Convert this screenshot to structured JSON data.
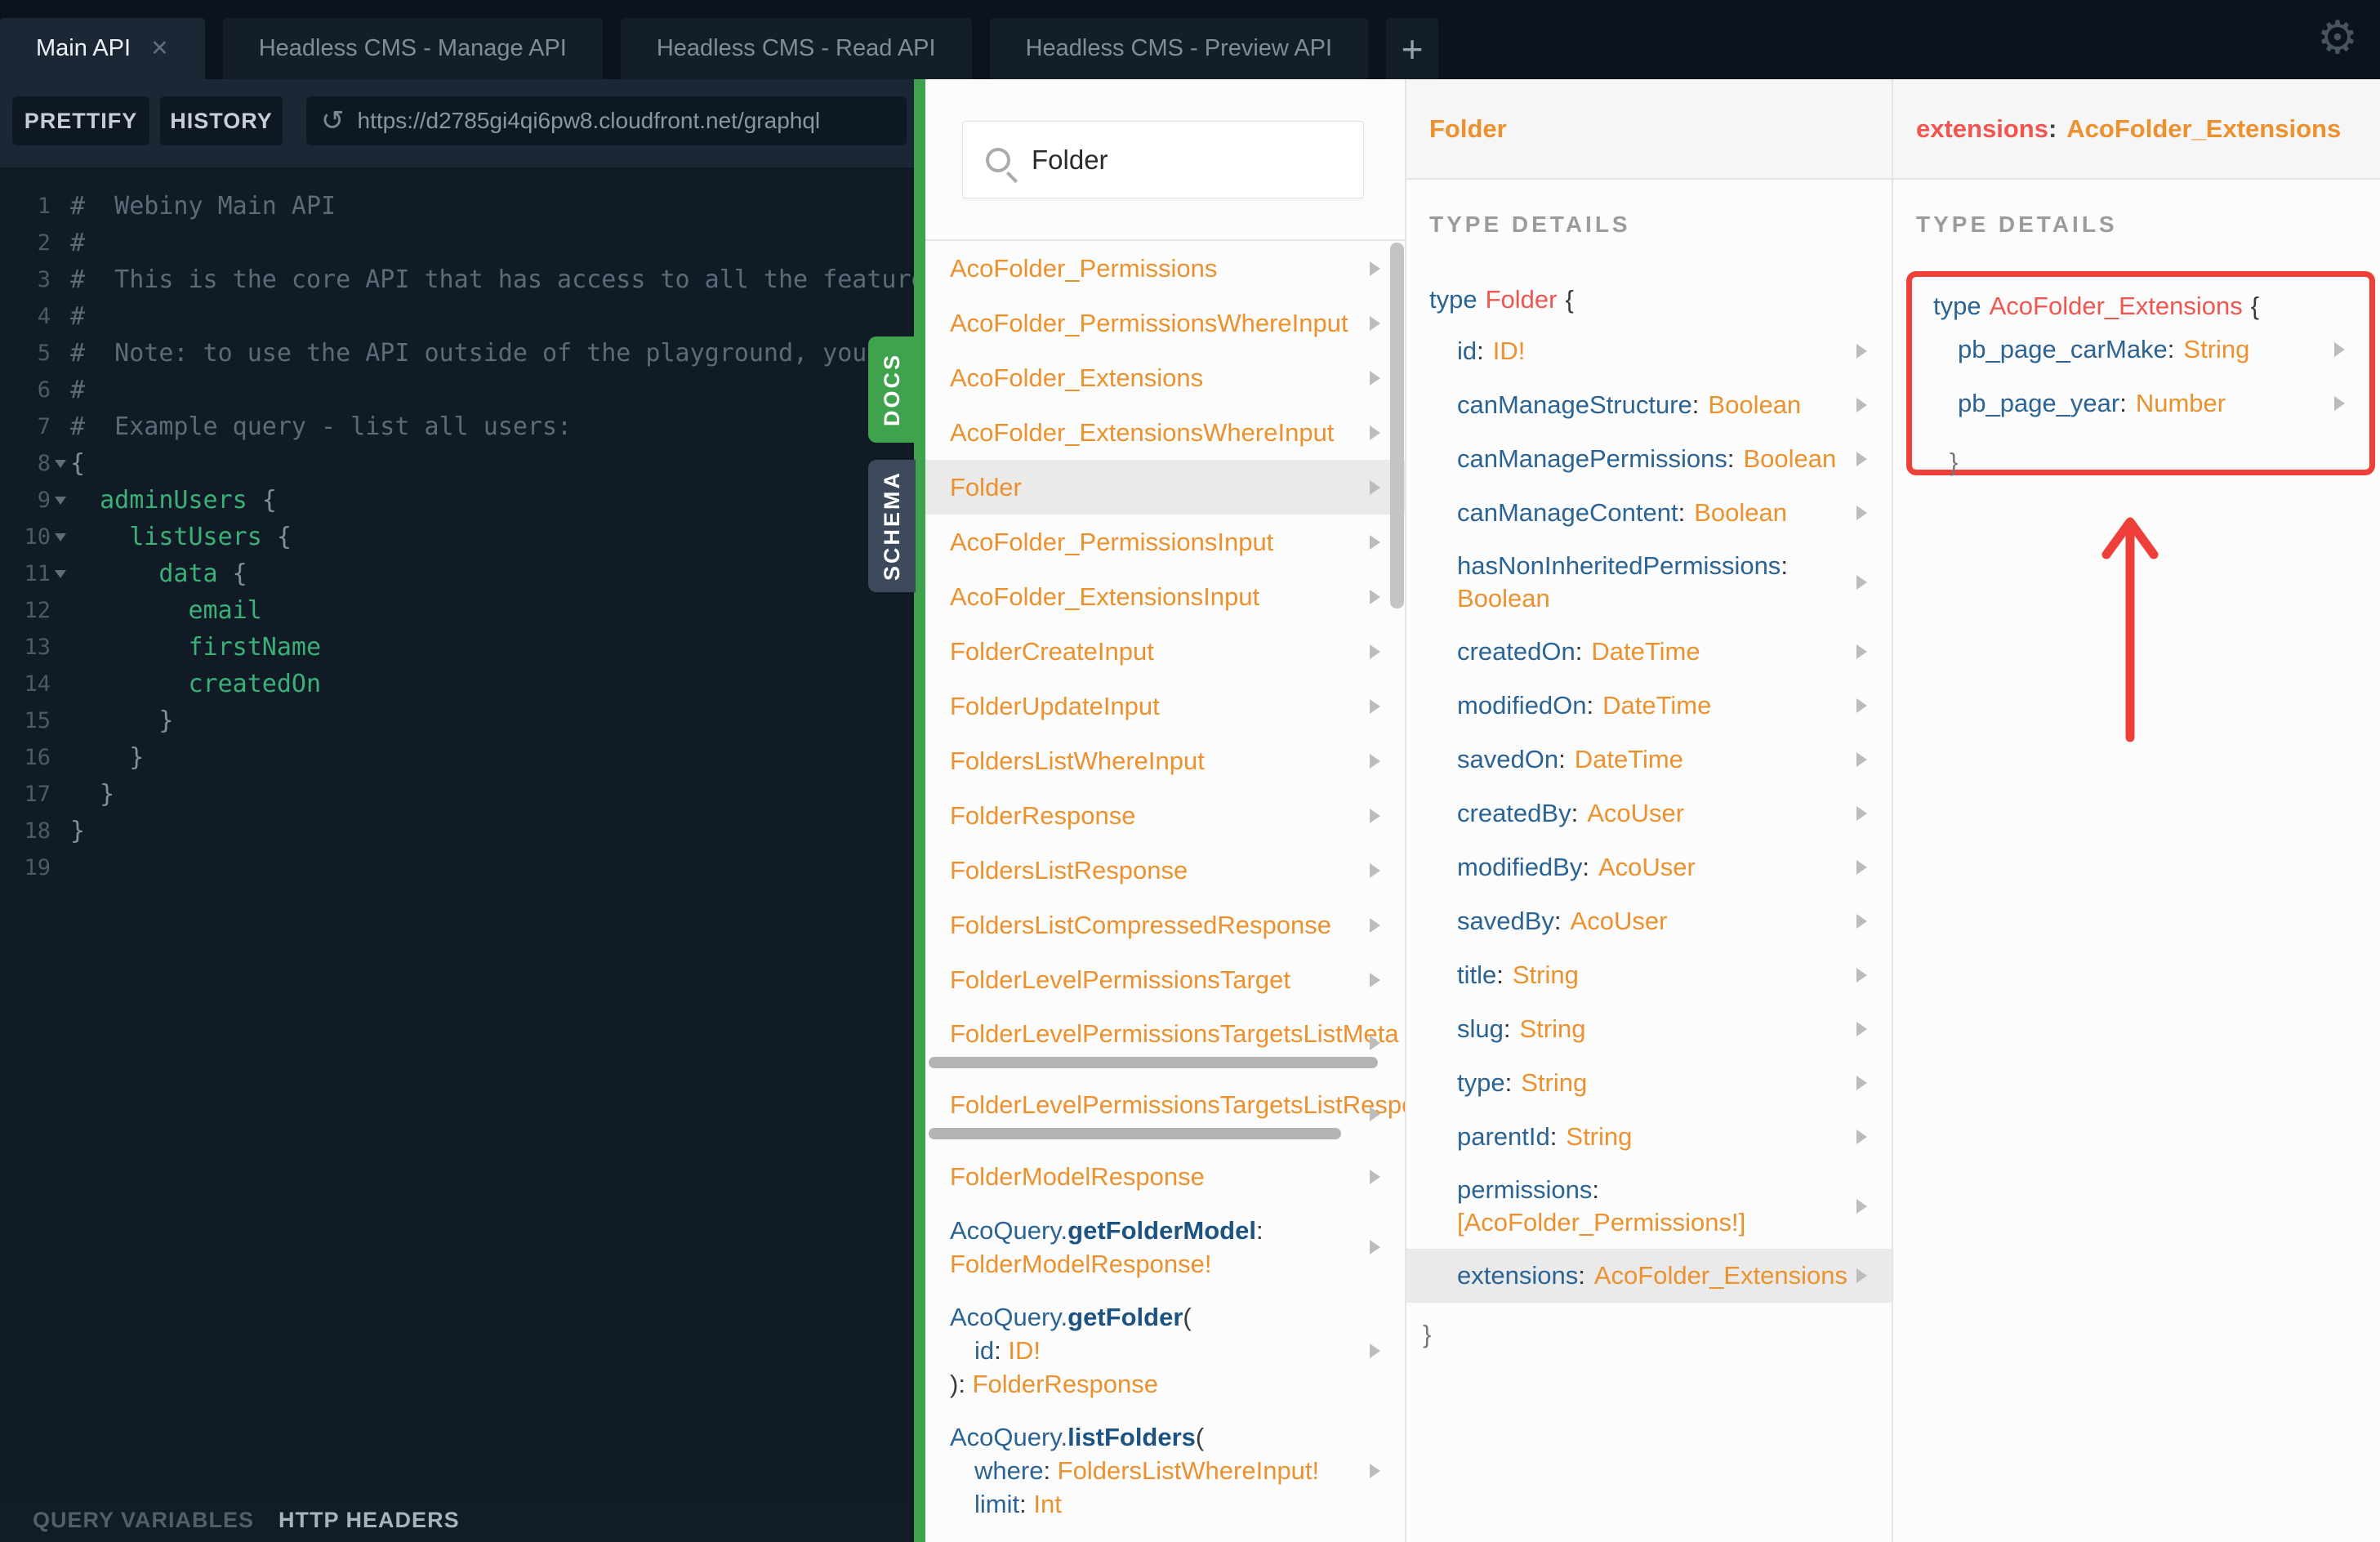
{
  "colors": {
    "accent_green": "#3fa34e",
    "annotation_red": "#ee3f38",
    "type_orange": "#ec912d",
    "field_blue": "#2a6394",
    "typename_red": "#f0564f"
  },
  "tabs": {
    "items": [
      {
        "label": "Main API",
        "active": true,
        "closable": true
      },
      {
        "label": "Headless CMS - Manage API",
        "active": false,
        "closable": false
      },
      {
        "label": "Headless CMS - Read API",
        "active": false,
        "closable": false
      },
      {
        "label": "Headless CMS - Preview API",
        "active": false,
        "closable": false
      }
    ],
    "new_tab_label": "+",
    "close_label": "✕",
    "gear_icon": "⚙"
  },
  "toolbar": {
    "prettify_label": "PRETTIFY",
    "history_label": "HISTORY",
    "history_icon": "↺",
    "url": "https://d2785gi4qi6pw8.cloudfront.net/graphql"
  },
  "editor": {
    "lines": [
      {
        "n": "1",
        "fold": false,
        "tokens": [
          {
            "t": "#  Webiny Main API",
            "c": "comment"
          }
        ]
      },
      {
        "n": "2",
        "fold": false,
        "tokens": [
          {
            "t": "#",
            "c": "comment"
          }
        ]
      },
      {
        "n": "3",
        "fold": false,
        "tokens": [
          {
            "t": "#  This is the core API that has access to all the features",
            "c": "comment"
          }
        ]
      },
      {
        "n": "4",
        "fold": false,
        "tokens": [
          {
            "t": "#",
            "c": "comment"
          }
        ]
      },
      {
        "n": "5",
        "fold": false,
        "tokens": [
          {
            "t": "#  Note: to use the API outside of the playground, you",
            "c": "comment"
          }
        ]
      },
      {
        "n": "6",
        "fold": false,
        "tokens": [
          {
            "t": "#",
            "c": "comment"
          }
        ]
      },
      {
        "n": "7",
        "fold": false,
        "tokens": [
          {
            "t": "#  Example query - list all users:",
            "c": "comment"
          }
        ]
      },
      {
        "n": "8",
        "fold": true,
        "tokens": [
          {
            "t": "{",
            "c": "brace"
          }
        ]
      },
      {
        "n": "9",
        "fold": true,
        "tokens": [
          {
            "t": "  ",
            "c": "brace"
          },
          {
            "t": "adminUsers",
            "c": "green"
          },
          {
            "t": " {",
            "c": "brace"
          }
        ]
      },
      {
        "n": "10",
        "fold": true,
        "tokens": [
          {
            "t": "    ",
            "c": "brace"
          },
          {
            "t": "listUsers",
            "c": "green"
          },
          {
            "t": " {",
            "c": "brace"
          }
        ]
      },
      {
        "n": "11",
        "fold": true,
        "tokens": [
          {
            "t": "      ",
            "c": "brace"
          },
          {
            "t": "data",
            "c": "green"
          },
          {
            "t": " {",
            "c": "brace"
          }
        ]
      },
      {
        "n": "12",
        "fold": false,
        "tokens": [
          {
            "t": "        ",
            "c": "brace"
          },
          {
            "t": "email",
            "c": "green"
          }
        ]
      },
      {
        "n": "13",
        "fold": false,
        "tokens": [
          {
            "t": "        ",
            "c": "brace"
          },
          {
            "t": "firstName",
            "c": "green"
          }
        ]
      },
      {
        "n": "14",
        "fold": false,
        "tokens": [
          {
            "t": "        ",
            "c": "brace"
          },
          {
            "t": "createdOn",
            "c": "green"
          }
        ]
      },
      {
        "n": "15",
        "fold": false,
        "tokens": [
          {
            "t": "      }",
            "c": "brace"
          }
        ]
      },
      {
        "n": "16",
        "fold": false,
        "tokens": [
          {
            "t": "    }",
            "c": "brace"
          }
        ]
      },
      {
        "n": "17",
        "fold": false,
        "tokens": [
          {
            "t": "  }",
            "c": "brace"
          }
        ]
      },
      {
        "n": "18",
        "fold": false,
        "tokens": [
          {
            "t": "}",
            "c": "brace"
          }
        ]
      },
      {
        "n": "19",
        "fold": false,
        "tokens": []
      }
    ]
  },
  "side_tabs": {
    "docs_label": "DOCS",
    "schema_label": "SCHEMA"
  },
  "bottom_bar": {
    "query_variables_label": "QUERY VARIABLES",
    "http_headers_label": "HTTP HEADERS"
  },
  "docs_panel": {
    "search_value": "Folder",
    "items": [
      {
        "arrow": true,
        "lines": [
          [
            {
              "t": "AcoFolder_Permissions",
              "c": "type"
            }
          ]
        ]
      },
      {
        "arrow": true,
        "lines": [
          [
            {
              "t": "AcoFolder_PermissionsWhereInput",
              "c": "type"
            }
          ]
        ]
      },
      {
        "arrow": true,
        "lines": [
          [
            {
              "t": "AcoFolder_Extensions",
              "c": "type"
            }
          ]
        ]
      },
      {
        "arrow": true,
        "lines": [
          [
            {
              "t": "AcoFolder_ExtensionsWhereInput",
              "c": "type"
            }
          ]
        ]
      },
      {
        "arrow": true,
        "highlight": true,
        "lines": [
          [
            {
              "t": "Folder",
              "c": "type"
            }
          ]
        ]
      },
      {
        "arrow": true,
        "lines": [
          [
            {
              "t": "AcoFolder_PermissionsInput",
              "c": "type"
            }
          ]
        ]
      },
      {
        "arrow": true,
        "lines": [
          [
            {
              "t": "AcoFolder_ExtensionsInput",
              "c": "type"
            }
          ]
        ]
      },
      {
        "arrow": true,
        "lines": [
          [
            {
              "t": "FolderCreateInput",
              "c": "type"
            }
          ]
        ]
      },
      {
        "arrow": true,
        "lines": [
          [
            {
              "t": "FolderUpdateInput",
              "c": "type"
            }
          ]
        ]
      },
      {
        "arrow": true,
        "lines": [
          [
            {
              "t": "FoldersListWhereInput",
              "c": "type"
            }
          ]
        ]
      },
      {
        "arrow": true,
        "lines": [
          [
            {
              "t": "FolderResponse",
              "c": "type"
            }
          ]
        ]
      },
      {
        "arrow": true,
        "lines": [
          [
            {
              "t": "FoldersListResponse",
              "c": "type"
            }
          ]
        ]
      },
      {
        "arrow": true,
        "lines": [
          [
            {
              "t": "FoldersListCompressedResponse",
              "c": "type"
            }
          ]
        ]
      },
      {
        "arrow": true,
        "lines": [
          [
            {
              "t": "FolderLevelPermissionsTarget",
              "c": "type"
            }
          ]
        ]
      },
      {
        "arrow": true,
        "hscroll": 550,
        "lines": [
          [
            {
              "t": "FolderLevelPermissionsTargetsListMeta",
              "c": "type"
            }
          ]
        ]
      },
      {
        "arrow": true,
        "hscroll": 505,
        "lines": [
          [
            {
              "t": "FolderLevelPermissionsTargetsListResponse",
              "c": "type"
            }
          ]
        ]
      },
      {
        "arrow": true,
        "lines": [
          [
            {
              "t": "FolderModelResponse",
              "c": "type"
            }
          ]
        ]
      },
      {
        "arrow": true,
        "lines": [
          [
            {
              "t": "AcoQuery.",
              "c": "blue"
            },
            {
              "t": "getFolderModel",
              "c": "bluebold"
            },
            {
              "t": ":",
              "c": "dark"
            }
          ],
          [
            {
              "t": "FolderModelResponse!",
              "c": "type"
            }
          ]
        ]
      },
      {
        "arrow": true,
        "lines": [
          [
            {
              "t": "AcoQuery.",
              "c": "blue"
            },
            {
              "t": "getFolder",
              "c": "bluebold"
            },
            {
              "t": "(",
              "c": "dark"
            }
          ],
          [
            {
              "t": "id",
              "c": "blue",
              "ml": 30
            },
            {
              "t": ": ",
              "c": "dark"
            },
            {
              "t": "ID!",
              "c": "type"
            }
          ],
          [
            {
              "t": "): ",
              "c": "dark"
            },
            {
              "t": "FolderResponse",
              "c": "type"
            }
          ]
        ]
      },
      {
        "arrow": true,
        "lines": [
          [
            {
              "t": "AcoQuery.",
              "c": "blue"
            },
            {
              "t": "listFolders",
              "c": "bluebold"
            },
            {
              "t": "(",
              "c": "dark"
            }
          ],
          [
            {
              "t": "where",
              "c": "blue",
              "ml": 30
            },
            {
              "t": ": ",
              "c": "dark"
            },
            {
              "t": "FoldersListWhereInput!",
              "c": "type"
            }
          ],
          [
            {
              "t": "limit",
              "c": "blue",
              "ml": 30
            },
            {
              "t": ": ",
              "c": "dark"
            },
            {
              "t": "Int",
              "c": "type"
            }
          ]
        ]
      }
    ]
  },
  "folder_panel": {
    "title": "Folder",
    "section_label": "TYPE DETAILS",
    "decl": {
      "keyword": "type",
      "name": "Folder",
      "brace": "{"
    },
    "fields": [
      {
        "name": "id",
        "type": "ID!"
      },
      {
        "name": "canManageStructure",
        "type": "Boolean"
      },
      {
        "name": "canManagePermissions",
        "type": "Boolean"
      },
      {
        "name": "canManageContent",
        "type": "Boolean"
      },
      {
        "name": "hasNonInheritedPermissions",
        "type": "Boolean",
        "wrap": true
      },
      {
        "name": "createdOn",
        "type": "DateTime"
      },
      {
        "name": "modifiedOn",
        "type": "DateTime"
      },
      {
        "name": "savedOn",
        "type": "DateTime"
      },
      {
        "name": "createdBy",
        "type": "AcoUser"
      },
      {
        "name": "modifiedBy",
        "type": "AcoUser"
      },
      {
        "name": "savedBy",
        "type": "AcoUser"
      },
      {
        "name": "title",
        "type": "String"
      },
      {
        "name": "slug",
        "type": "String"
      },
      {
        "name": "type",
        "type": "String"
      },
      {
        "name": "parentId",
        "type": "String"
      },
      {
        "name": "permissions",
        "type": "[AcoFolder_Permissions!]",
        "wrap": true
      },
      {
        "name": "extensions",
        "type": "AcoFolder_Extensions",
        "highlight": true
      }
    ],
    "closing_brace": "}"
  },
  "extensions_panel": {
    "header": {
      "field": "extensions",
      "colon": ":",
      "type": "AcoFolder_Extensions"
    },
    "section_label": "TYPE DETAILS",
    "decl": {
      "keyword": "type",
      "name": "AcoFolder_Extensions",
      "brace": "{"
    },
    "fields": [
      {
        "name": "pb_page_carMake",
        "type": "String"
      },
      {
        "name": "pb_page_year",
        "type": "Number"
      }
    ],
    "closing_brace": "}"
  }
}
